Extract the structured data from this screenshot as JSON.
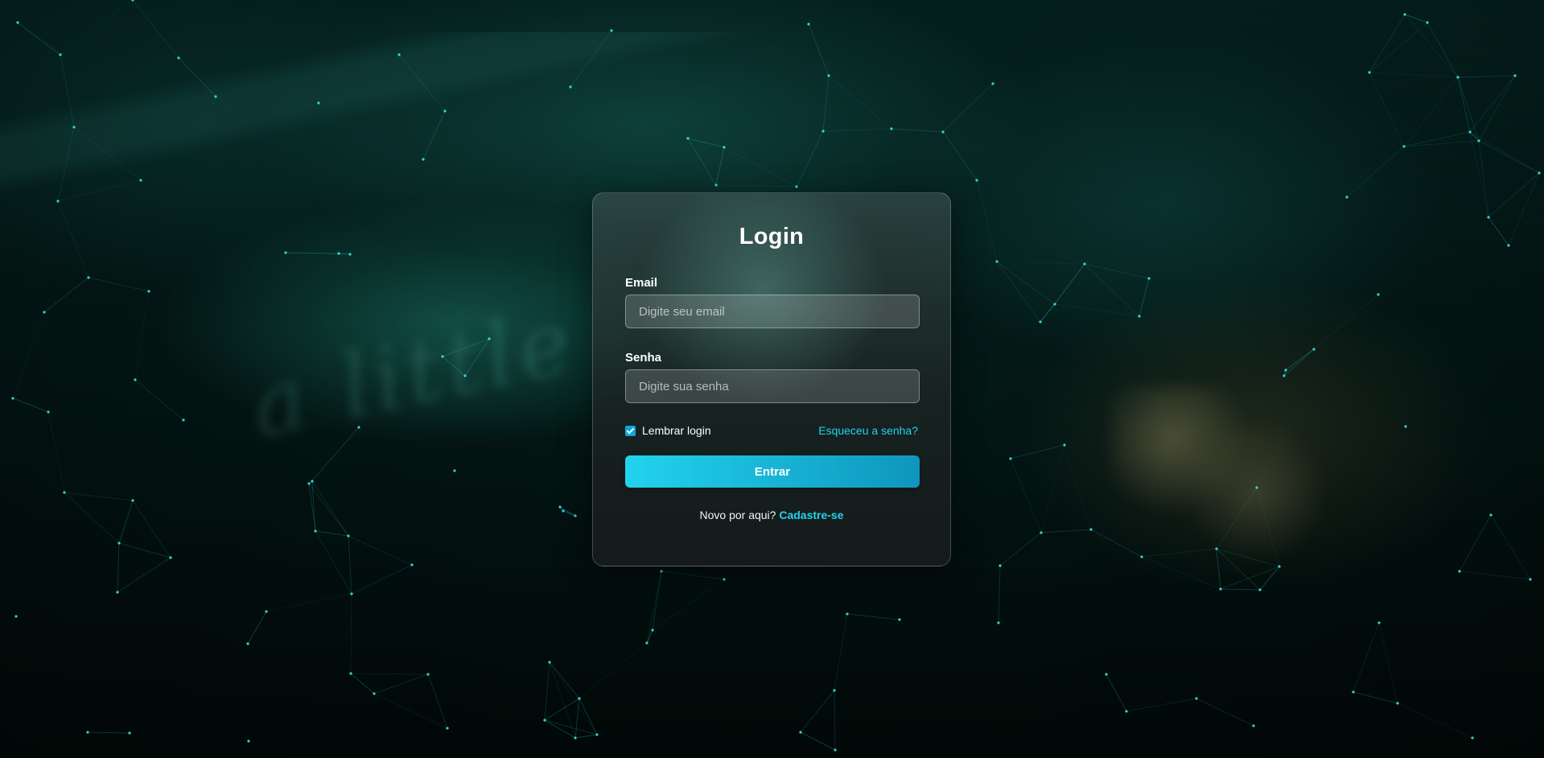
{
  "login": {
    "title": "Login",
    "email": {
      "label": "Email",
      "placeholder": "Digite seu email"
    },
    "password": {
      "label": "Senha",
      "placeholder": "Digite sua senha"
    },
    "remember": {
      "label": "Lembrar login",
      "checked": true
    },
    "forgot_link": "Esqueceu a senha?",
    "submit_label": "Entrar",
    "signup_prompt": "Novo por aqui?",
    "signup_link": "Cadastre-se"
  },
  "colors": {
    "accent": "#22d3ee",
    "button_gradient_start": "#22d3ee",
    "button_gradient_end": "#0e96bd",
    "checkbox": "#0ea5d8",
    "network_lines": "#28dce1",
    "background_dark": "#031411"
  }
}
